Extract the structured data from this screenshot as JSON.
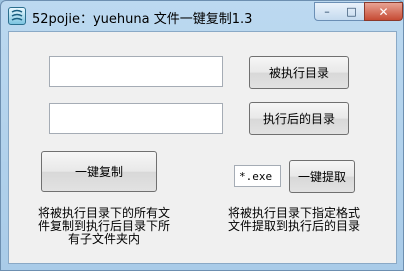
{
  "window": {
    "title": "52pojie：yuehuna 文件一键复制1.3"
  },
  "controls": {
    "minimize_glyph": "–",
    "maximize_glyph": "□",
    "close_glyph": "✕"
  },
  "form": {
    "source_dir_value": "",
    "target_dir_value": "",
    "source_dir_button": "被执行目录",
    "target_dir_button": "执行后的目录",
    "copy_button": "一键复制",
    "extension_value": "*.exe",
    "extract_button": "一键提取"
  },
  "descriptions": {
    "copy_desc_lines": [
      "将被执行目录下的所有文",
      "件复制到执行后目录下所",
      "有子文件夹内"
    ],
    "extract_desc_lines": [
      "将被执行目录下指定格式",
      "文件提取到执行后的目录"
    ]
  },
  "colors": {
    "frame": "#a9cbe8",
    "client": "#f0f0f0",
    "close": "#c64b34"
  },
  "icons": {
    "app": "app-icon"
  }
}
